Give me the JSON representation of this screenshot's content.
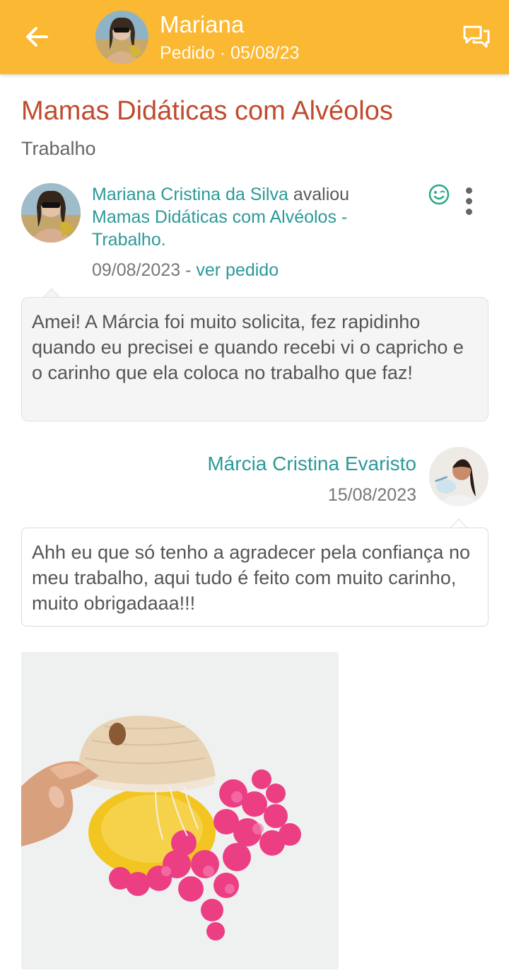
{
  "header": {
    "name": "Mariana",
    "subtitle": "Pedido · 05/08/23",
    "accent": "#FBB832"
  },
  "product": {
    "title": "Mamas Didáticas com Alvéolos",
    "category": "Trabalho"
  },
  "review": {
    "author": "Mariana Cristina da Silva",
    "action": "avaliou",
    "product_link": "Mamas Didáticas com Alvéolos - Trabalho",
    "period": ".",
    "date": "09/08/2023",
    "separator": "-",
    "order_link": "ver pedido",
    "text": "Amei! A Márcia foi muito solicita, fez rapidinho quando eu precisei e quando recebi vi o capricho e o carinho que ela coloca no trabalho que faz!"
  },
  "reply": {
    "author": "Márcia Cristina Evaristo",
    "date": "15/08/2023",
    "text": "Ahh eu que só tenho a agradecer pela confiança no meu trabalho, aqui tudo é feito com muito carinho, muito obrigadaaa!!!"
  },
  "icons": {
    "back": "arrow-left",
    "chat": "chat-bubbles",
    "rating": "smile-face",
    "menu": "kebab-vertical"
  },
  "colors": {
    "title": "#BF4B2F",
    "link": "#2B9A98"
  }
}
